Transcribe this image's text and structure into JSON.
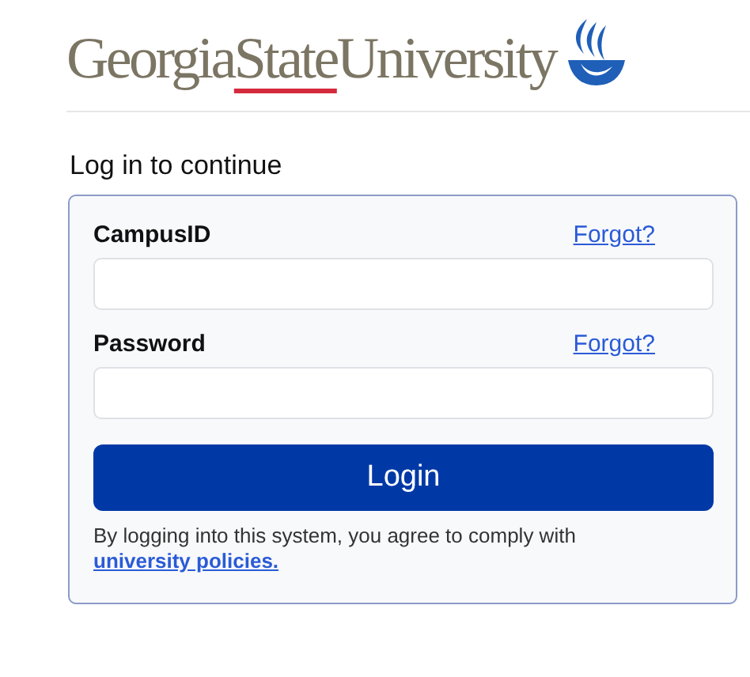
{
  "logo": {
    "parts": [
      {
        "text": "Georgia",
        "underlined": false
      },
      {
        "text": "State",
        "underlined": true
      },
      {
        "text": "University",
        "underlined": false
      }
    ]
  },
  "heading": "Log in to continue",
  "fields": [
    {
      "label": "CampusID",
      "link": "Forgot?"
    },
    {
      "label": "Password",
      "link": "Forgot?"
    }
  ],
  "login_button": "Login",
  "notice": {
    "text": "By logging into this system, you agree to comply with ",
    "link": "university policies."
  }
}
